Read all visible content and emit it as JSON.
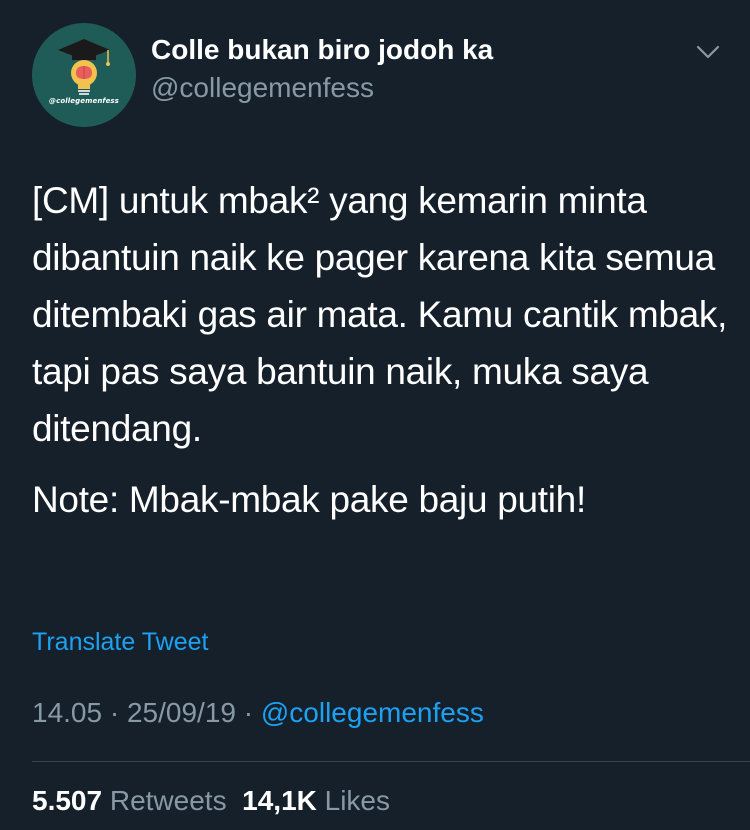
{
  "author": {
    "display_name": "Colle bukan biro jodoh ka",
    "screen_name": "@collegemenfess",
    "avatar_text": "@collegemenfess"
  },
  "tweet": {
    "paragraph_1": "[CM] untuk mbak² yang kemarin minta dibantuin naik ke pager karena kita semua ditembaki gas air mata. Kamu cantik mbak, tapi pas saya bantuin naik, muka saya ditendang.",
    "paragraph_2": "Note: Mbak-mbak pake baju putih!",
    "translate_label": "Translate Tweet"
  },
  "meta": {
    "time": "14.05",
    "separator": " · ",
    "date": "25/09/19",
    "via": "@collegemenfess"
  },
  "stats": {
    "retweets_count": "5.507",
    "retweets_label": "Retweets",
    "likes_count": "14,1K",
    "likes_label": "Likes"
  },
  "icons": {
    "caret": "chevron-down-icon",
    "avatar_logo": "graduation-cap-bulb-icon"
  },
  "colors": {
    "background": "#15202b",
    "primary_text": "#ffffff",
    "secondary_text": "#8899a6",
    "accent": "#1da1f2",
    "divider": "#38444d",
    "avatar_bg": "#1f5c57"
  }
}
